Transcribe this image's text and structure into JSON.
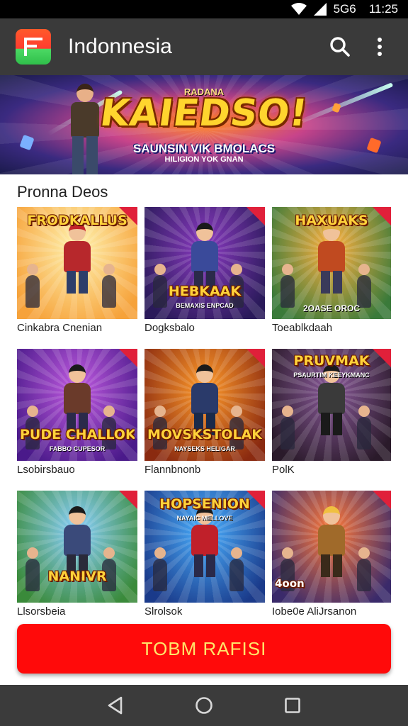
{
  "status_bar": {
    "network": "5G6",
    "time": "11:25"
  },
  "app_bar": {
    "title": "Indonnesia",
    "logo_icon": "app-logo-icon",
    "search_icon": "search-icon",
    "menu_icon": "more-vert-icon"
  },
  "banner": {
    "kicker": "RADANA",
    "title": "KAIEDSO!",
    "subtitle": "SAUNSIN VIK BMOLACS",
    "tagline": "HILIGION YOK GNAN"
  },
  "section": {
    "title": "Pronna Deos"
  },
  "games": [
    {
      "label": "Cinkabra Cnenian",
      "title": "FRODKALLUS",
      "sub": "",
      "colors": {
        "bg1": "#fff3b0",
        "bg2": "#f6a23a",
        "hair": "#c4222a",
        "shirt": "#b7282c",
        "pants": "#2d3e6a"
      }
    },
    {
      "label": "Dogksbalo",
      "title": "HEBKAAK",
      "sub": "BEMAXIS ENPCAD",
      "colors": {
        "bg1": "#8a3ac0",
        "bg2": "#2a1a5a",
        "hair": "#1a1a1a",
        "shirt": "#3a4a9a",
        "pants": "#2a2a4a"
      }
    },
    {
      "label": "Toeablkdaah",
      "title": "HAXUAKS",
      "sub": "2OASE OROC",
      "colors": {
        "bg1": "#ffb040",
        "bg2": "#3a7a3a",
        "hair": "#e0b040",
        "shirt": "#c04a20",
        "pants": "#3a3a5a"
      }
    },
    {
      "label": "Lsobirsbauo",
      "title": "PUDE CHALLOK",
      "sub": "FABBO CUPESOR",
      "colors": {
        "bg1": "#c05ae0",
        "bg2": "#4a1a8a",
        "hair": "#1a1a1a",
        "shirt": "#6a3a2a",
        "pants": "#2a2a4a"
      }
    },
    {
      "label": "Flannbnonb",
      "title": "MOVSKSTOLAK",
      "sub": "NAYSEKS HELIGAR",
      "colors": {
        "bg1": "#ff9a2a",
        "bg2": "#8a2a10",
        "hair": "#1a1a1a",
        "shirt": "#2a3a6a",
        "pants": "#1a2a4a"
      }
    },
    {
      "label": "PolK",
      "title": "PRUVMAK",
      "sub": "PSAURTIM KEEYKMANC",
      "colors": {
        "bg1": "#8a5a9a",
        "bg2": "#2a1a2a",
        "hair": "#1a1a1a",
        "shirt": "#3a3a3a",
        "pants": "#1a1a1a"
      }
    },
    {
      "label": "Llsorsbeia",
      "title": "NANIVR",
      "sub": "",
      "colors": {
        "bg1": "#8ad0ff",
        "bg2": "#3a8a3a",
        "hair": "#1a1a1a",
        "shirt": "#3a4a7a",
        "pants": "#2a2a3a"
      }
    },
    {
      "label": "Slrolsok",
      "title": "HOPSENION",
      "sub": "NAYAIC MELLOVE",
      "colors": {
        "bg1": "#4ab0ff",
        "bg2": "#1a3a8a",
        "hair": "#1a1a1a",
        "shirt": "#c0202a",
        "pants": "#2a2a4a"
      }
    },
    {
      "label": "Iobe0e AliJrsanon",
      "title": "4oon",
      "sub": "",
      "colors": {
        "bg1": "#ff7a3a",
        "bg2": "#3a2a6a",
        "hair": "#f0c040",
        "shirt": "#a06a2a",
        "pants": "#3a2a1a"
      }
    }
  ],
  "cta": {
    "label": "TOBM RAFISI"
  },
  "nav_bar": {
    "back_icon": "back-icon",
    "home_icon": "home-icon",
    "recents_icon": "recents-icon"
  }
}
